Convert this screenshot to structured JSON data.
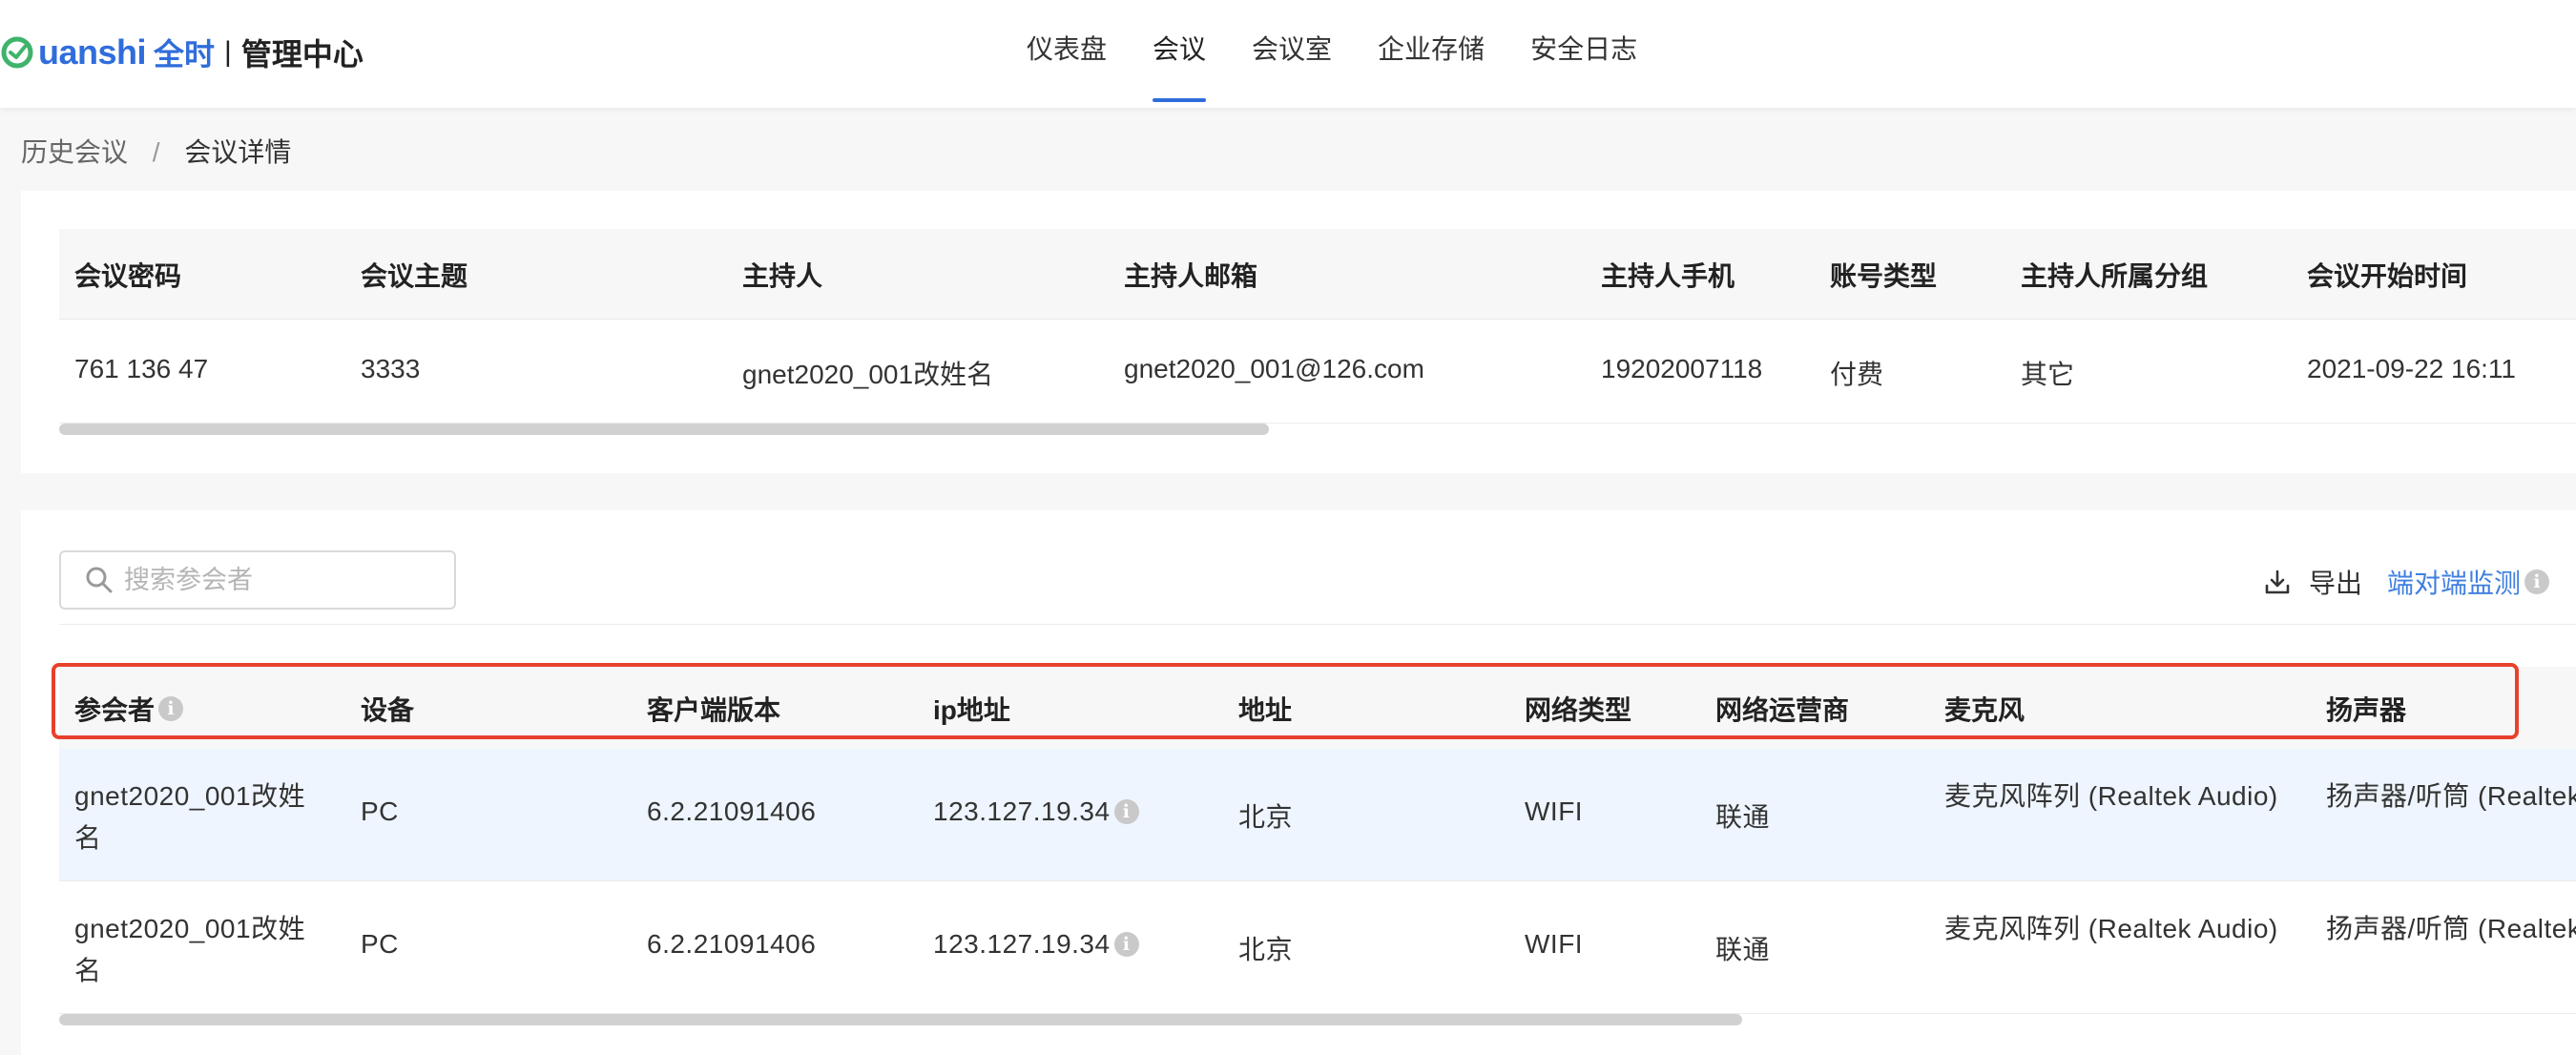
{
  "header": {
    "brand": "uanshi",
    "brand_cn": "全时",
    "separator": "|",
    "center_title": "管理中心",
    "nav": [
      {
        "label": "仪表盘",
        "active": false
      },
      {
        "label": "会议",
        "active": true
      },
      {
        "label": "会议室",
        "active": false
      },
      {
        "label": "企业存储",
        "active": false
      },
      {
        "label": "安全日志",
        "active": false
      }
    ]
  },
  "breadcrumb": {
    "parent": "历史会议",
    "separator": "/",
    "current": "会议详情"
  },
  "meeting_info": {
    "columns": [
      "会议密码",
      "会议主题",
      "主持人",
      "主持人邮箱",
      "主持人手机",
      "账号类型",
      "主持人所属分组",
      "会议开始时间"
    ],
    "row": [
      "761 136 47",
      "3333",
      "gnet2020_001改姓名",
      "gnet2020_001@126.com",
      "19202007118",
      "付费",
      "其它",
      "2021-09-22 16:11"
    ]
  },
  "participants": {
    "search_placeholder": "搜索参会者",
    "export_label": "导出",
    "monitor_label": "端对端监测",
    "info_glyph": "i",
    "columns": [
      "参会者",
      "设备",
      "客户端版本",
      "ip地址",
      "地址",
      "网络类型",
      "网络运营商",
      "麦克风",
      "扬声器"
    ],
    "rows": [
      {
        "name": "gnet2020_001改姓名",
        "device": "PC",
        "version": "6.2.21091406",
        "ip": "123.127.19.34",
        "location": "北京",
        "network": "WIFI",
        "carrier": "联通",
        "mic": "麦克风阵列 (Realtek Audio)",
        "speaker": "扬声器/听筒 (Realtek Audio)"
      },
      {
        "name": "gnet2020_001改姓名",
        "device": "PC",
        "version": "6.2.21091406",
        "ip": "123.127.19.34",
        "location": "北京",
        "network": "WIFI",
        "carrier": "联通",
        "mic": "麦克风阵列 (Realtek Audio)",
        "speaker": "扬声器/听筒 (Realtek Audio)"
      }
    ]
  },
  "colors": {
    "accent": "#2f6ddb",
    "link": "#3f7fe0",
    "highlight": "#e8412b",
    "logo_green": "#3fb36c"
  }
}
